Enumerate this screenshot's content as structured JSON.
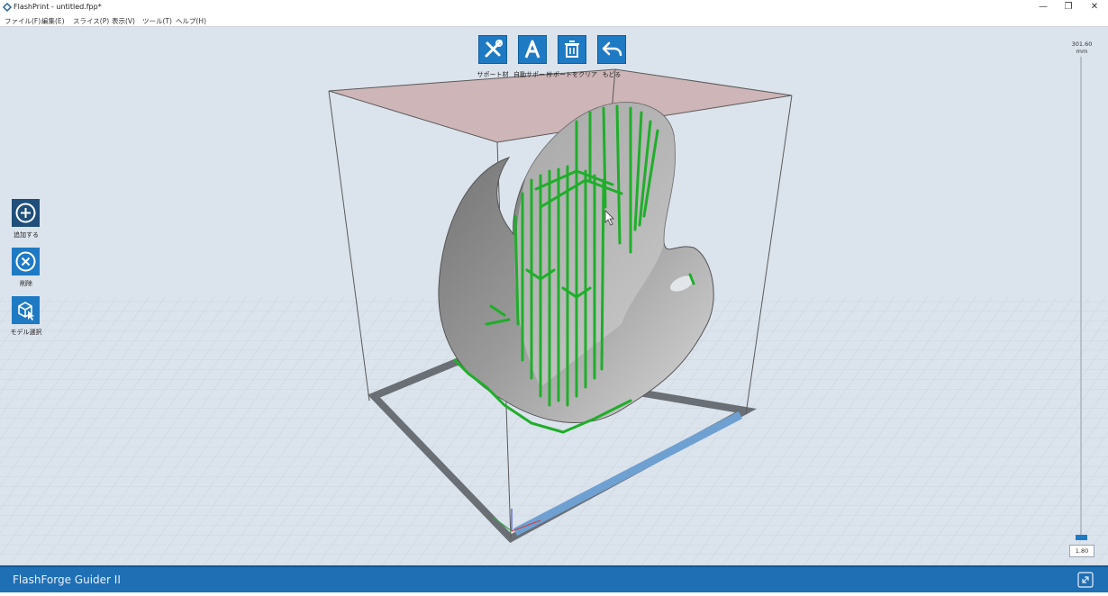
{
  "window": {
    "title": "FlashPrint - untitled.fpp*",
    "minimize": "—",
    "maximize": "❐",
    "close": "✕"
  },
  "menu": [
    "ファイル(F)",
    "編集(E)",
    "スライス(P)",
    "表示(V)",
    "ツール(T)",
    "ヘルプ(H)"
  ],
  "toolbar": [
    {
      "label": "サポート材",
      "icon": "wrench-screwdriver-icon"
    },
    {
      "label": "自動サポート",
      "icon": "letter-a-icon"
    },
    {
      "label": "サポートをクリア",
      "icon": "trash-icon"
    },
    {
      "label": "もどる",
      "icon": "undo-arrow-icon"
    }
  ],
  "sidebar": [
    {
      "label": "追加する",
      "icon": "plus-circle-icon"
    },
    {
      "label": "削除",
      "icon": "x-circle-icon"
    },
    {
      "label": "モデル選択",
      "icon": "cube-cursor-icon"
    }
  ],
  "layer_slider": {
    "max_value": "301.60",
    "unit": "mm",
    "current_value": "1.80"
  },
  "status": {
    "printer_name": "FlashForge Guider II",
    "icon": "link-icon"
  },
  "colors": {
    "accent": "#1f7ac4",
    "statusbar": "#1f6fb5",
    "support": "#22b02a",
    "model": "#8a8a8a",
    "build_top": "#c9a0a0"
  }
}
